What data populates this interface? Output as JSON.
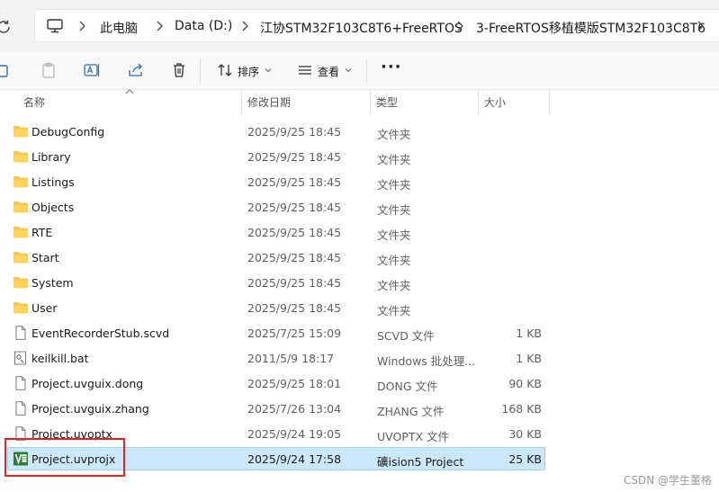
{
  "breadcrumbs": [
    "此电脑",
    "Data (D:)",
    "江协STM32F103C8T6+FreeRTOS",
    "3-FreeRTOS移植模版STM32F103C8T6"
  ],
  "toolbar": {
    "sort_label": "排序",
    "view_label": "查看",
    "more_label": "···"
  },
  "columns": {
    "name": "名称",
    "date": "修改日期",
    "type": "类型",
    "size": "大小"
  },
  "files": [
    {
      "name": "DebugConfig",
      "date": "2025/9/25 18:45",
      "type": "文件夹",
      "size": "",
      "icon": "folder-icon"
    },
    {
      "name": "Library",
      "date": "2025/9/25 18:45",
      "type": "文件夹",
      "size": "",
      "icon": "folder-icon"
    },
    {
      "name": "Listings",
      "date": "2025/9/25 18:45",
      "type": "文件夹",
      "size": "",
      "icon": "folder-icon"
    },
    {
      "name": "Objects",
      "date": "2025/9/25 18:45",
      "type": "文件夹",
      "size": "",
      "icon": "folder-icon"
    },
    {
      "name": "RTE",
      "date": "2025/9/25 18:45",
      "type": "文件夹",
      "size": "",
      "icon": "folder-icon"
    },
    {
      "name": "Start",
      "date": "2025/9/25 18:45",
      "type": "文件夹",
      "size": "",
      "icon": "folder-icon"
    },
    {
      "name": "System",
      "date": "2025/9/25 18:45",
      "type": "文件夹",
      "size": "",
      "icon": "folder-icon"
    },
    {
      "name": "User",
      "date": "2025/9/25 18:45",
      "type": "文件夹",
      "size": "",
      "icon": "folder-icon"
    },
    {
      "name": "EventRecorderStub.scvd",
      "date": "2025/7/25 15:09",
      "type": "SCVD 文件",
      "size": "1 KB",
      "icon": "file-icon"
    },
    {
      "name": "keilkill.bat",
      "date": "2011/5/9 18:17",
      "type": "Windows 批处理...",
      "size": "1 KB",
      "icon": "batch-file-icon"
    },
    {
      "name": "Project.uvguix.dong",
      "date": "2025/9/25 18:01",
      "type": "DONG 文件",
      "size": "90 KB",
      "icon": "file-icon"
    },
    {
      "name": "Project.uvguix.zhang",
      "date": "2025/7/26 13:04",
      "type": "ZHANG 文件",
      "size": "168 KB",
      "icon": "file-icon"
    },
    {
      "name": "Project.uvoptx",
      "date": "2025/9/24 19:05",
      "type": "UVOPTX 文件",
      "size": "30 KB",
      "icon": "file-icon"
    },
    {
      "name": "Project.uvprojx",
      "date": "2025/9/24 17:58",
      "type": "礦ision5 Project",
      "size": "25 KB",
      "icon": "keil-project-icon",
      "selected": true
    }
  ],
  "watermark": "CSDN @学生董格",
  "colors": {
    "selection_bg": "#cce8ff",
    "selection_border": "#99d1ff",
    "folder": "#f4c542",
    "highlight_box": "#e8221b"
  }
}
